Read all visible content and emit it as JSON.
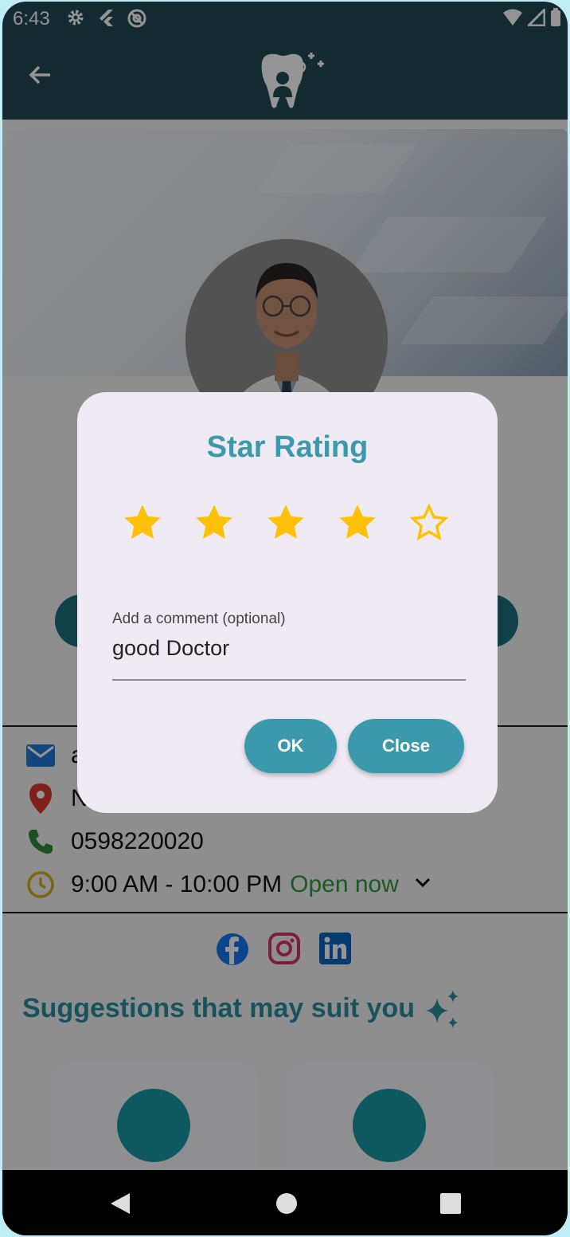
{
  "status_bar": {
    "time": "6:43"
  },
  "app_bar": {
    "logo": "tooth-logo"
  },
  "dialog": {
    "title": "Star Rating",
    "rating": 4,
    "max_rating": 5,
    "comment_label": "Add a comment (optional)",
    "comment_value": "good Doctor",
    "ok_label": "OK",
    "close_label": "Close"
  },
  "info": {
    "email_partial": "a",
    "address_partial": "N",
    "phone": "0598220020",
    "hours": "9:00 AM - 10:00 PM",
    "open_status": "Open now"
  },
  "suggestions_title": "Suggestions that may suit you",
  "colors": {
    "primary": "#3a9aac",
    "appbar": "#1f4954",
    "star": "#ffc107",
    "open": "#2f9a3b"
  }
}
